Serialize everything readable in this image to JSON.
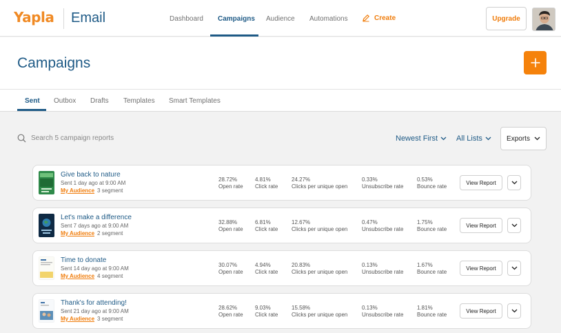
{
  "brand": {
    "logo": "Yapla",
    "app_name": "Email"
  },
  "nav": {
    "items": [
      "Dashboard",
      "Campaigns",
      "Audience",
      "Automations"
    ],
    "active": "Campaigns",
    "create_label": "Create",
    "upgrade_label": "Upgrade"
  },
  "page": {
    "title": "Campaigns"
  },
  "tabs": {
    "items": [
      "Sent",
      "Outbox",
      "Drafts",
      "Templates",
      "Smart Templates"
    ],
    "active": "Sent"
  },
  "toolbar": {
    "search_placeholder": "Search 5 campaign reports",
    "sort_label": "Newest First",
    "list_label": "All Lists",
    "exports_label": "Exports"
  },
  "stat_labels": [
    "Open rate",
    "Click rate",
    "Clicks per unique open",
    "Unsubscribe rate",
    "Bounce rate"
  ],
  "view_report_label": "View Report",
  "campaigns": [
    {
      "title": "Give back to nature",
      "sent": "Sent 1 day ago at 9:00 AM",
      "audience": "My Audience",
      "segment": "3 segment",
      "stats": [
        "28.72%",
        "4.81%",
        "24.27%",
        "0.33%",
        "0.53%"
      ],
      "thumb": "nature"
    },
    {
      "title": "Let's make a difference",
      "sent": "Sent 7 days ago at 9:00 AM",
      "audience": "My Audience",
      "segment": "2 segment",
      "stats": [
        "32.88%",
        "6.81%",
        "12.67%",
        "0.47%",
        "1.75%"
      ],
      "thumb": "earth"
    },
    {
      "title": "Time to donate",
      "sent": "Sent 14 day ago at 9:00 AM",
      "audience": "My Audience",
      "segment": "4 segment",
      "stats": [
        "30.07%",
        "4.94%",
        "20.83%",
        "0.13%",
        "1.67%"
      ],
      "thumb": "donate"
    },
    {
      "title": "Thank's for attending!",
      "sent": "Sent 21 day ago at 9:00 AM",
      "audience": "My Audience",
      "segment": "3 segment",
      "stats": [
        "28.62%",
        "9.03%",
        "15.58%",
        "0.13%",
        "1.81%"
      ],
      "thumb": "event"
    }
  ],
  "colors": {
    "brand_orange": "#f5820b",
    "brand_blue": "#1e5a86",
    "background": "#f2f2f2"
  }
}
